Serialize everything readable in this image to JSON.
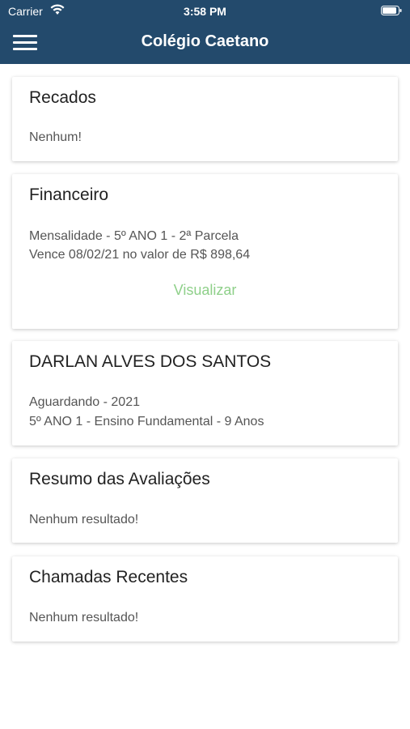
{
  "status_bar": {
    "carrier": "Carrier",
    "time": "3:58 PM"
  },
  "header": {
    "title": "Colégio Caetano",
    "color": "#234a6c"
  },
  "cards": [
    {
      "title": "Recados",
      "lines": [
        "Nenhum!"
      ]
    },
    {
      "title": "Financeiro",
      "lines": [
        "Mensalidade - 5º ANO 1 - 2ª Parcela",
        "Vence 08/02/21 no valor de R$ 898,64"
      ],
      "link": "Visualizar"
    },
    {
      "title": "DARLAN ALVES DOS SANTOS",
      "lines": [
        "Aguardando - 2021",
        "5º ANO 1 - Ensino Fundamental - 9 Anos"
      ]
    },
    {
      "title": "Resumo das Avaliações",
      "lines": [
        "Nenhum resultado!"
      ]
    },
    {
      "title": "Chamadas Recentes",
      "lines": [
        "Nenhum resultado!"
      ]
    }
  ],
  "link_color": "#8fd08a"
}
